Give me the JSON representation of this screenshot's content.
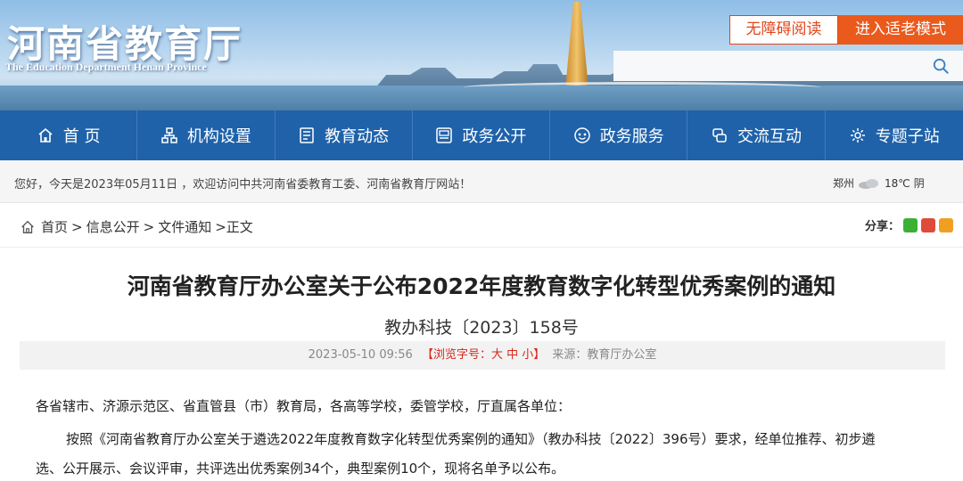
{
  "header": {
    "site_title": "河南省教育厅",
    "site_subtitle": "The Education Department Henan Province",
    "accessibility_label": "无障碍阅读",
    "elderly_mode_label": "进入适老模式",
    "search_placeholder": ""
  },
  "nav": {
    "items": [
      {
        "label": "首 页",
        "icon": "home-icon"
      },
      {
        "label": "机构设置",
        "icon": "org-icon"
      },
      {
        "label": "教育动态",
        "icon": "news-icon"
      },
      {
        "label": "政务公开",
        "icon": "doc-icon"
      },
      {
        "label": "政务服务",
        "icon": "service-icon"
      },
      {
        "label": "交流互动",
        "icon": "chat-icon"
      },
      {
        "label": "专题子站",
        "icon": "topic-icon"
      }
    ]
  },
  "welcome": {
    "text": "您好，今天是2023年05月11日 ，欢迎访问中共河南省委教育工委、河南省教育厅网站！",
    "city": "郑州",
    "temperature": "18℃",
    "condition": "阴"
  },
  "breadcrumb": {
    "items": [
      "首页",
      "信息公开",
      "文件通知"
    ],
    "current": "正文",
    "sep": ">"
  },
  "share": {
    "label": "分享："
  },
  "article": {
    "title": "河南省教育厅办公室关于公布2022年度教育数字化转型优秀案例的通知",
    "doc_number": "教办科技〔2023〕158号",
    "date": "2023-05-10 09:56",
    "font_size_control": "【浏览字号：大 中 小】",
    "source": "来源：教育厅办公室",
    "paragraphs": [
      "各省辖市、济源示范区、省直管县（市）教育局，各高等学校，委管学校，厅直属各单位：",
      "按照《河南省教育厅办公室关于遴选2022年度教育数字化转型优秀案例的通知》（教办科技〔2022〕396号）要求，经单位推荐、初步遴",
      "选、公开展示、会议评审，共评选出优秀案例34个，典型案例10个，现将名单予以公布。"
    ]
  },
  "colors": {
    "nav_blue": "#1f62aa",
    "accent_orange": "#ea5a1c",
    "font_control_red": "#d8261c"
  }
}
